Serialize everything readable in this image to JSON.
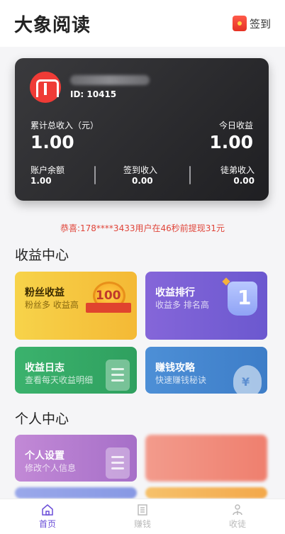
{
  "header": {
    "title": "大象阅读",
    "checkin_label": "签到"
  },
  "account": {
    "id_text": "ID: 10415",
    "total_income_label": "累计总收入（元）",
    "total_income_value": "1.00",
    "today_income_label": "今日收益",
    "today_income_value": "1.00",
    "balance_label": "账户余额",
    "balance_value": "1.00",
    "checkin_income_label": "签到收入",
    "checkin_income_value": "0.00",
    "apprentice_income_label": "徒弟收入",
    "apprentice_income_value": "0.00"
  },
  "notice": "恭喜:178****3433用户在46秒前提现31元",
  "income_center": {
    "title": "收益中心",
    "tiles": [
      {
        "title": "粉丝收益",
        "subtitle": "粉丝多 收益高",
        "badge": "100"
      },
      {
        "title": "收益排行",
        "subtitle": "收益多 排名高",
        "badge": "1"
      },
      {
        "title": "收益日志",
        "subtitle": "查看每天收益明细"
      },
      {
        "title": "赚钱攻略",
        "subtitle": "快速赚钱秘诀",
        "badge": "¥"
      }
    ]
  },
  "personal_center": {
    "title": "个人中心",
    "tiles": [
      {
        "title": "个人设置",
        "subtitle": "修改个人信息"
      }
    ]
  },
  "tabbar": {
    "items": [
      {
        "label": "首页",
        "icon": "home-icon",
        "active": true
      },
      {
        "label": "赚钱",
        "icon": "list-icon",
        "active": false
      },
      {
        "label": "收徒",
        "icon": "apprentice-icon",
        "active": false
      }
    ]
  },
  "colors": {
    "accent": "#6b4fd8",
    "notice": "#e0453a"
  }
}
